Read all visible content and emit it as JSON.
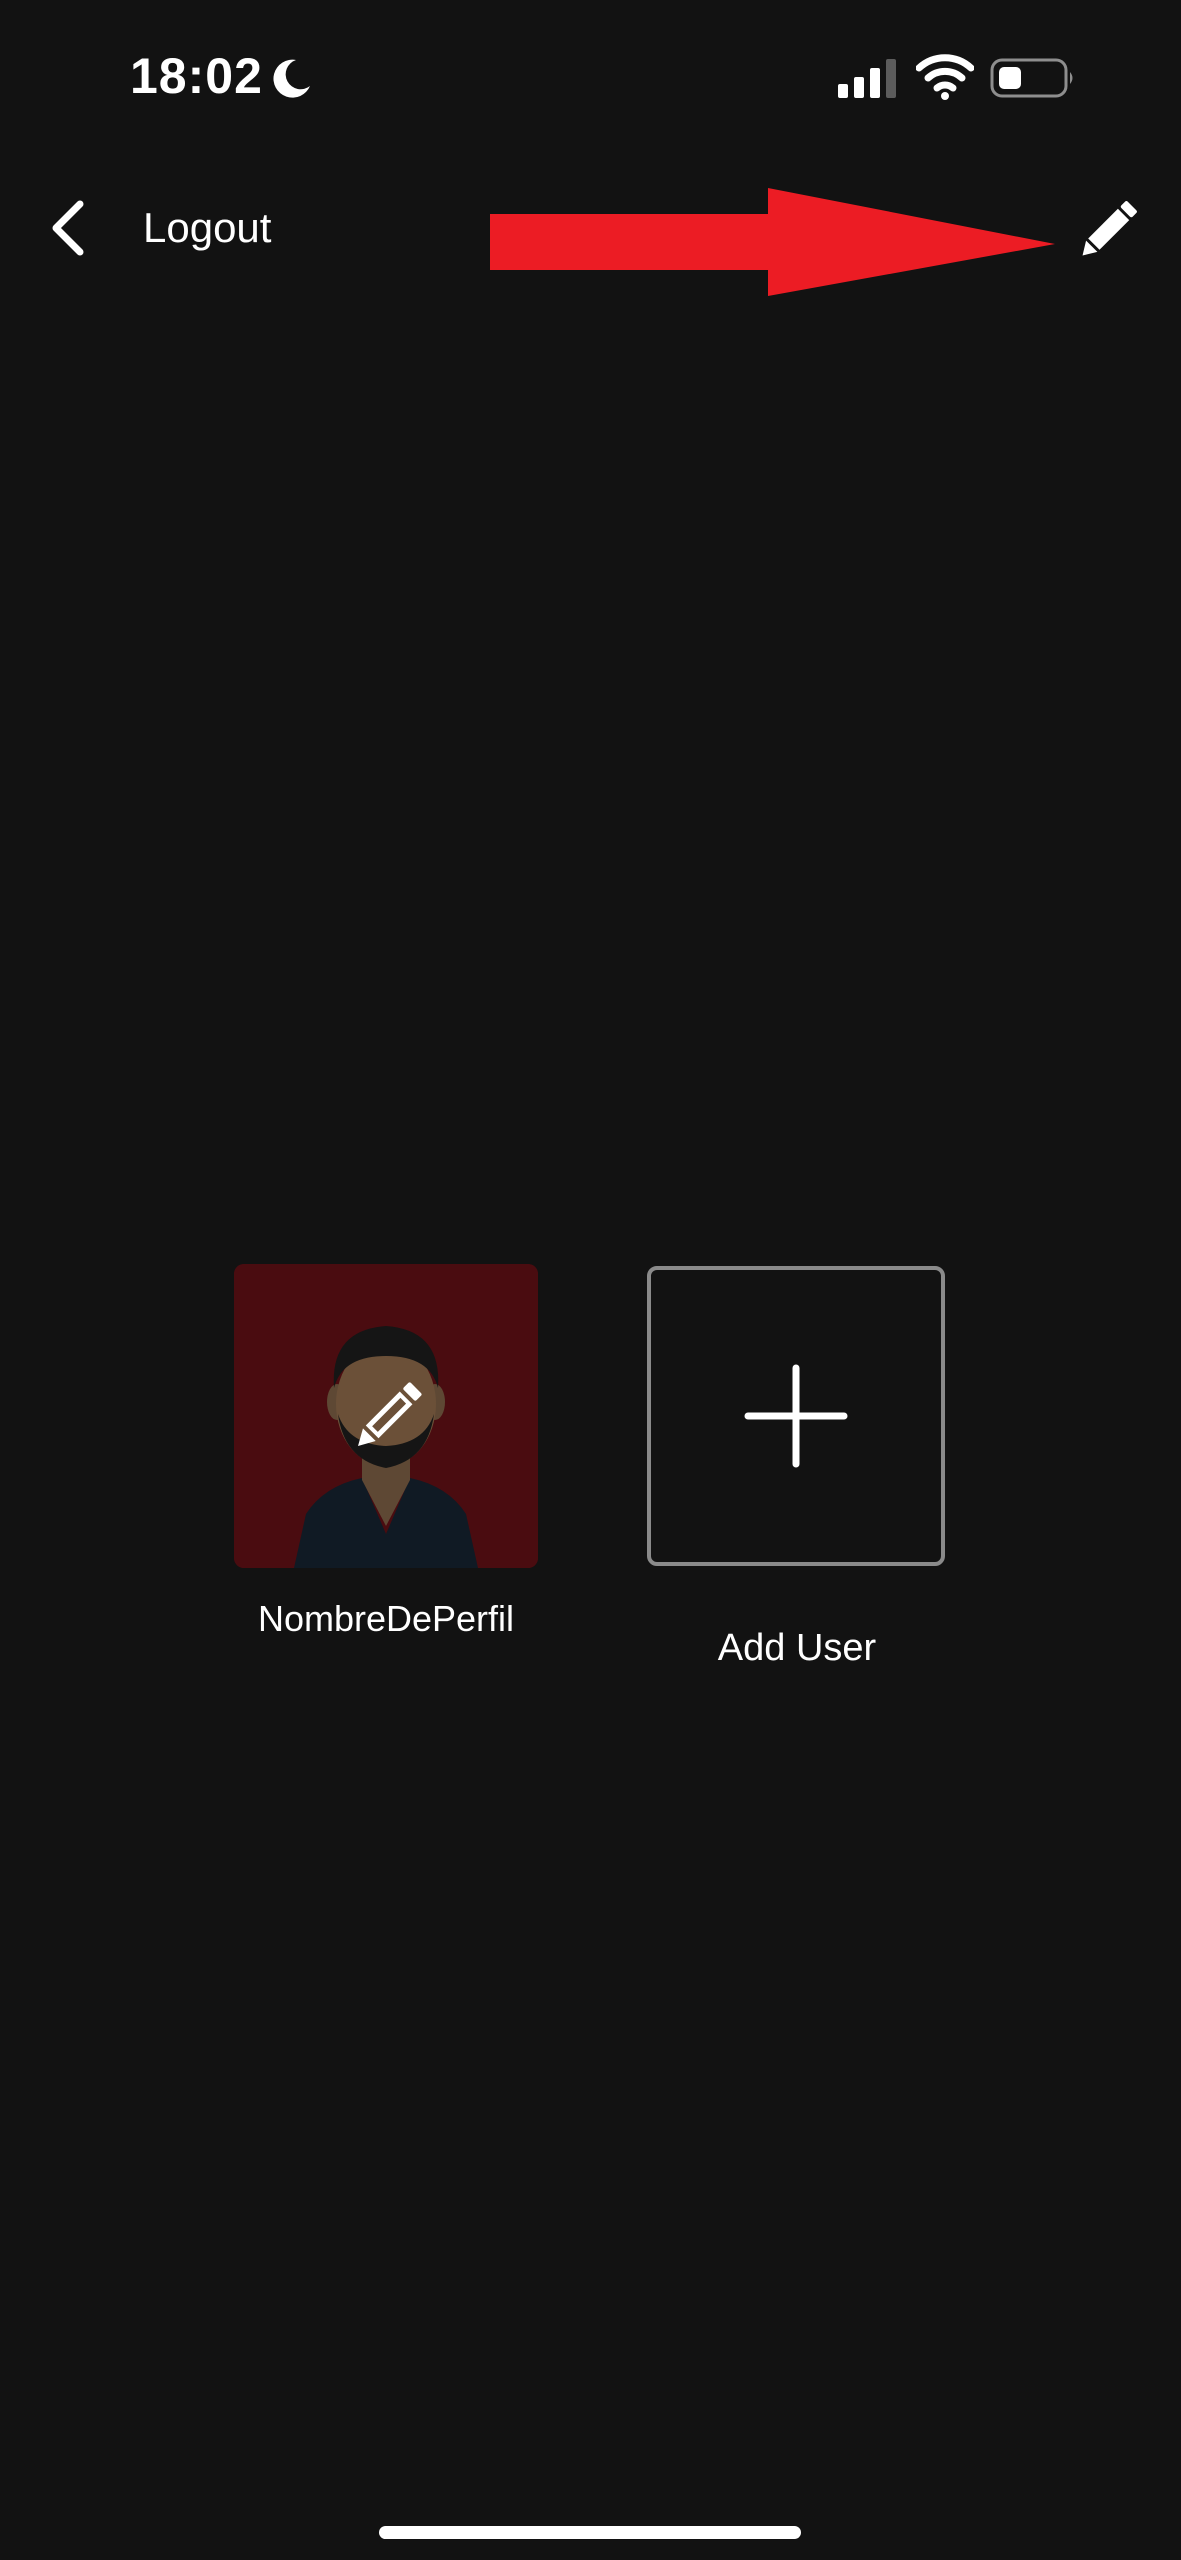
{
  "status_bar": {
    "time": "18:02",
    "icons": [
      "moon-icon",
      "cellular-signal-icon",
      "wifi-icon",
      "battery-icon"
    ]
  },
  "nav": {
    "back_icon": "chevron-left-icon",
    "logout_label": "Logout",
    "edit_icon": "pencil-icon",
    "annotation_icon": "red-arrow-annotation"
  },
  "profiles": [
    {
      "name": "NombreDePerfil",
      "avatar_icon": "person-avatar-icon",
      "overlay_icon": "pencil-icon"
    }
  ],
  "add_user": {
    "label": "Add User",
    "icon": "plus-icon"
  },
  "colors": {
    "background": "#121212",
    "annotation_red": "#ec1c24",
    "profile_tile_bg": "#4a0c10",
    "add_tile_border": "#8a8a8a"
  }
}
